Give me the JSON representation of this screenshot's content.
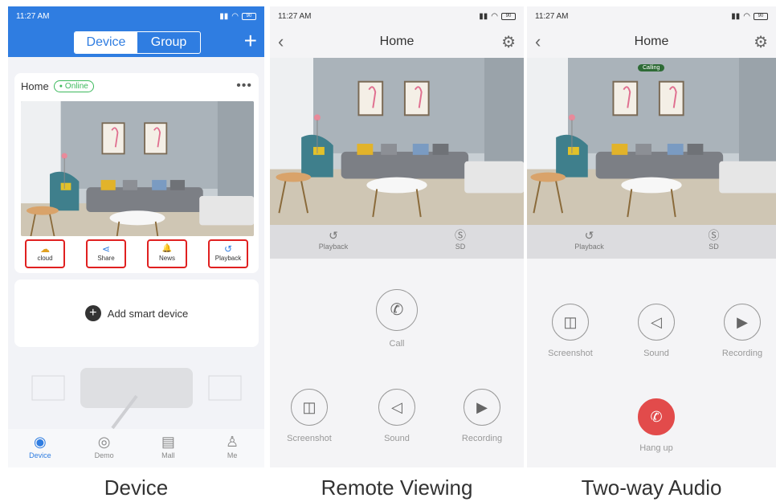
{
  "status": {
    "time": "11:27 AM",
    "battery": "90"
  },
  "device_screen": {
    "segments": [
      "Device",
      "Group"
    ],
    "plus": "+",
    "card_title": "Home",
    "online": "Online",
    "more": "•••",
    "actions": [
      {
        "label": "cloud",
        "icon": "cloud-icon",
        "glyph": "☁"
      },
      {
        "label": "Share",
        "icon": "share-icon",
        "glyph": "⋖"
      },
      {
        "label": "News",
        "icon": "bell-icon",
        "glyph": "🔔"
      },
      {
        "label": "Playback",
        "icon": "playback-icon",
        "glyph": "↺"
      }
    ],
    "add_label": "Add smart device",
    "add_glyph": "+",
    "tabs": [
      {
        "label": "Device",
        "icon": "device-icon",
        "glyph": "◉"
      },
      {
        "label": "Demo",
        "icon": "demo-icon",
        "glyph": "◎"
      },
      {
        "label": "Mall",
        "icon": "mall-icon",
        "glyph": "▤"
      },
      {
        "label": "Me",
        "icon": "me-icon",
        "glyph": "♙"
      }
    ]
  },
  "remote_screen": {
    "title": "Home",
    "back": "‹",
    "gear": "⚙",
    "bar": [
      {
        "label": "Playback",
        "glyph": "↺"
      },
      {
        "label": "SD",
        "glyph": "Ⓢ"
      }
    ],
    "call": {
      "label": "Call",
      "glyph": "✆"
    },
    "buttons": [
      {
        "label": "Screenshot",
        "glyph": "◫"
      },
      {
        "label": "Sound",
        "glyph": "◁"
      },
      {
        "label": "Recording",
        "glyph": "▶"
      }
    ]
  },
  "audio_screen": {
    "title": "Home",
    "back": "‹",
    "gear": "⚙",
    "calling": "Calling",
    "bar": [
      {
        "label": "Playback",
        "glyph": "↺"
      },
      {
        "label": "SD",
        "glyph": "Ⓢ"
      }
    ],
    "buttons": [
      {
        "label": "Screenshot",
        "glyph": "◫"
      },
      {
        "label": "Sound",
        "glyph": "◁"
      },
      {
        "label": "Recording",
        "glyph": "▶"
      }
    ],
    "hangup": {
      "label": "Hang up",
      "glyph": "✆"
    }
  },
  "captions": [
    "Device",
    "Remote Viewing",
    "Two-way Audio"
  ],
  "colors": {
    "brand_blue": "#2f7de1",
    "highlight_red": "#e02020",
    "online_green": "#3cb95c",
    "hangup_red": "#e24b4b"
  }
}
